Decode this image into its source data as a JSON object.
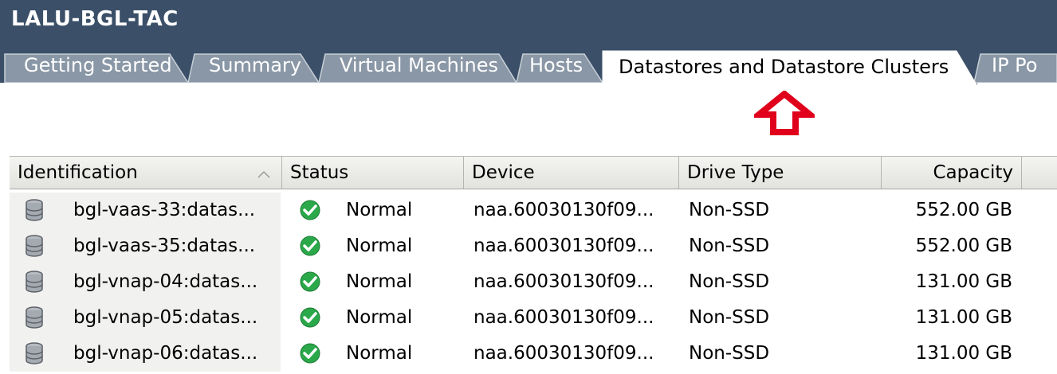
{
  "window": {
    "title": "LALU-BGL-TAC"
  },
  "tabs": [
    {
      "label": "Getting Started"
    },
    {
      "label": "Summary"
    },
    {
      "label": "Virtual Machines"
    },
    {
      "label": "Hosts"
    },
    {
      "label": "Datastores and Datastore Clusters",
      "active": true
    },
    {
      "label": "IP Po"
    }
  ],
  "annotation": {
    "icon": "red-up-arrow-icon",
    "color": "#e0001b"
  },
  "table": {
    "columns": [
      "Identification",
      "Status",
      "Device",
      "Drive Type",
      "Capacity"
    ],
    "sort": {
      "column": "Identification",
      "direction": "ascending"
    },
    "rows": [
      {
        "identification": "bgl-vaas-33:datas...",
        "status": "Normal",
        "device": "naa.60030130f09...",
        "drive_type": "Non-SSD",
        "capacity": "552.00 GB"
      },
      {
        "identification": "bgl-vaas-35:datas...",
        "status": "Normal",
        "device": "naa.60030130f09...",
        "drive_type": "Non-SSD",
        "capacity": "552.00 GB"
      },
      {
        "identification": "bgl-vnap-04:datas...",
        "status": "Normal",
        "device": "naa.60030130f09...",
        "drive_type": "Non-SSD",
        "capacity": "131.00 GB"
      },
      {
        "identification": "bgl-vnap-05:datas...",
        "status": "Normal",
        "device": "naa.60030130f09...",
        "drive_type": "Non-SSD",
        "capacity": "131.00 GB"
      },
      {
        "identification": "bgl-vnap-06:datas...",
        "status": "Normal",
        "device": "naa.60030130f09...",
        "drive_type": "Non-SSD",
        "capacity": "131.00 GB"
      }
    ]
  },
  "icons": {
    "row_icon": "datastore-icon",
    "status_icon": "status-ok-check-icon"
  },
  "colors": {
    "header_bg": "#3b5068",
    "tab_inactive": "#8a97a6",
    "tab_active": "#ffffff",
    "status_ok": "#2aa84a"
  }
}
